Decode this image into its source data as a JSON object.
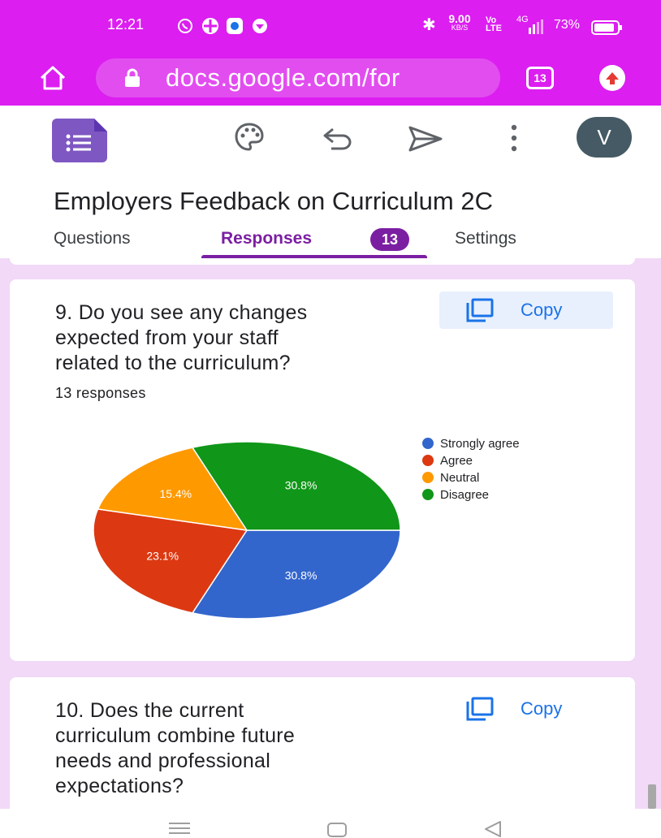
{
  "status_bar": {
    "time": "12:21",
    "speed": "9.00",
    "speed_unit": "KB/S",
    "network": "4G",
    "battery": "73%"
  },
  "browser": {
    "url": "docs.google.com/for",
    "tab_count": "13"
  },
  "form": {
    "avatar_letter": "V",
    "title": "Employers Feedback on Curriculum 2C",
    "tabs": [
      {
        "label": "Questions"
      },
      {
        "label": "Responses",
        "badge": "13"
      },
      {
        "label": "Settings"
      }
    ]
  },
  "questions": [
    {
      "text_lines": [
        "9. Do you see any changes",
        "expected from your staff",
        "related to the curriculum?"
      ],
      "copy_label": "Copy",
      "responses_text": "13 responses"
    },
    {
      "text_lines": [
        "10. Does the current",
        "curriculum combine future",
        "needs and professional",
        "expectations?"
      ],
      "copy_label": "Copy"
    }
  ],
  "chart_data": {
    "type": "pie",
    "categories": [
      "Strongly agree",
      "Agree",
      "Neutral",
      "Disagree"
    ],
    "values": [
      30.8,
      23.1,
      15.4,
      30.8
    ],
    "labels": [
      "30.8%",
      "23.1%",
      "15.4%",
      "30.8%"
    ],
    "colors": [
      "#3366cc",
      "#dc3912",
      "#ff9900",
      "#109618"
    ],
    "legend_position": "right"
  },
  "colors": {
    "browser_bar": "#dc1ef0",
    "accent_purple": "#673ab7",
    "responses_tab": "#7b1fa2",
    "page_background": "#f1d9f7",
    "link_blue": "#1a73e8"
  }
}
